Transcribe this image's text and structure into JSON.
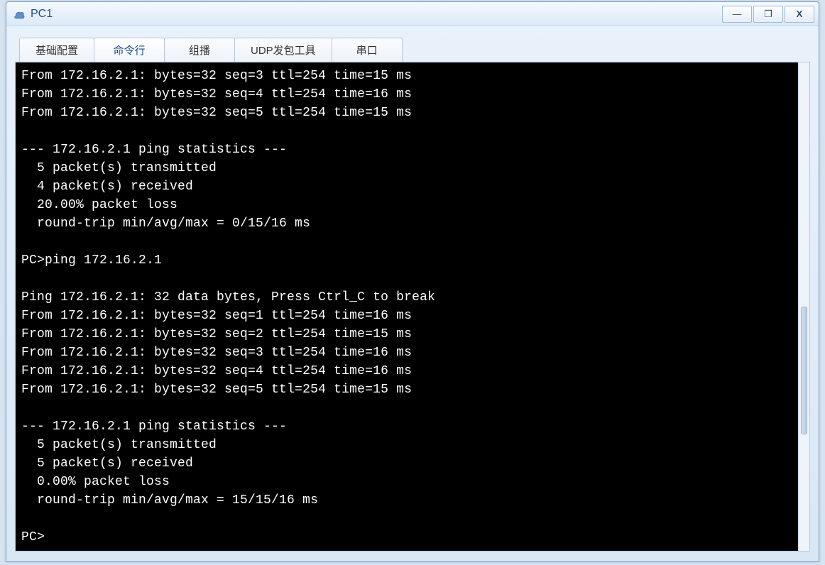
{
  "window": {
    "title": "PC1"
  },
  "controls": {
    "minimize": "—",
    "maximize": "❐",
    "close": "X"
  },
  "tabs": [
    {
      "label": "基础配置",
      "active": false
    },
    {
      "label": "命令行",
      "active": true
    },
    {
      "label": "组播",
      "active": false
    },
    {
      "label": "UDP发包工具",
      "active": false
    },
    {
      "label": "串口",
      "active": false
    }
  ],
  "terminal": {
    "lines": [
      "From 172.16.2.1: bytes=32 seq=3 ttl=254 time=15 ms",
      "From 172.16.2.1: bytes=32 seq=4 ttl=254 time=16 ms",
      "From 172.16.2.1: bytes=32 seq=5 ttl=254 time=15 ms",
      "",
      "--- 172.16.2.1 ping statistics ---",
      "  5 packet(s) transmitted",
      "  4 packet(s) received",
      "  20.00% packet loss",
      "  round-trip min/avg/max = 0/15/16 ms",
      "",
      "PC>ping 172.16.2.1",
      "",
      "Ping 172.16.2.1: 32 data bytes, Press Ctrl_C to break",
      "From 172.16.2.1: bytes=32 seq=1 ttl=254 time=16 ms",
      "From 172.16.2.1: bytes=32 seq=2 ttl=254 time=15 ms",
      "From 172.16.2.1: bytes=32 seq=3 ttl=254 time=16 ms",
      "From 172.16.2.1: bytes=32 seq=4 ttl=254 time=16 ms",
      "From 172.16.2.1: bytes=32 seq=5 ttl=254 time=15 ms",
      "",
      "--- 172.16.2.1 ping statistics ---",
      "  5 packet(s) transmitted",
      "  5 packet(s) received",
      "  0.00% packet loss",
      "  round-trip min/avg/max = 15/15/16 ms",
      "",
      "PC>"
    ]
  }
}
